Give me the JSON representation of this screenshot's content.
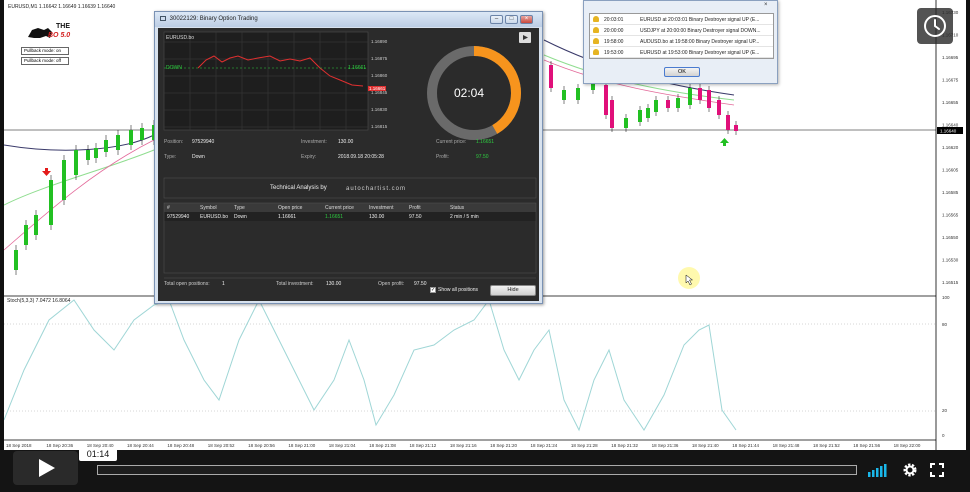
{
  "chart": {
    "header_text": "EURUSD,M1 1.16642 1.16649 1.16639 1.16640",
    "logo_text": "THE",
    "logo_bo": "BO 5.0",
    "pullback_on": "Pullback mode: on",
    "pullback_off": "Pullback mode: off",
    "stoch_label": "Stoch(5,3,3) 7.0472 16.8064",
    "price_ticks": [
      "1.16730",
      "1.16710",
      "1.16695",
      "1.16675",
      "1.16655",
      "1.16640",
      "1.16620",
      "1.16605",
      "1.16585",
      "1.16565",
      "1.16550",
      "1.16530",
      "1.16515"
    ],
    "current_price_tag": "1.16640",
    "stoch_ticks": [
      "100",
      "80",
      "20",
      "0"
    ],
    "time_ticks": [
      "18 Sep 2018",
      "18 Sep 20:36",
      "18 Sep 20:40",
      "18 Sep 20:44",
      "18 Sep 20:48",
      "18 Sep 20:52",
      "18 Sep 20:56",
      "18 Sep 21:00",
      "18 Sep 21:04",
      "18 Sep 21:08",
      "18 Sep 21:12",
      "18 Sep 21:16",
      "18 Sep 21:20",
      "18 Sep 21:24",
      "18 Sep 21:28",
      "18 Sep 21:32",
      "18 Sep 21:36",
      "18 Sep 21:40",
      "18 Sep 21:44",
      "18 Sep 21:48",
      "18 Sep 21:52",
      "18 Sep 21:56",
      "18 Sep 22:00"
    ]
  },
  "bo_window": {
    "title": "30022129: Binary Option Trading",
    "mini_chart_symbol": "EURUSD.bo",
    "down_label": "DOWN",
    "mini_price_tag": "1.16661",
    "mini_ticks": [
      "1.16890",
      "1.16875",
      "1.16860",
      "1.16845",
      "1.16830",
      "1.16815"
    ],
    "mini_current": "1.16661",
    "timer": "02:04",
    "position_label": "Position:",
    "position_value": "97529940",
    "investment_label": "Investment:",
    "investment_value": "130.00",
    "current_price_label": "Current price:",
    "current_price_value": "1.16651",
    "type_label": "Type:",
    "type_value": "Down",
    "expiry_label": "Expiry:",
    "expiry_value": "2018.09.18 20:05:28",
    "profit_label": "Profit:",
    "profit_value": "97.50",
    "ta_label": "Technical Analysis by",
    "ta_brand": "autochartist.com",
    "table_headers": [
      "#",
      "Symbol",
      "Type",
      "Open price",
      "Current price",
      "Investment",
      "Profit",
      "Status"
    ],
    "table_row": [
      "97529940",
      "EURUSD.bo",
      "Down",
      "1.16661",
      "1.16651",
      "130.00",
      "97.50",
      "2 min / 5 min"
    ],
    "total_open_label": "Total open positions:",
    "total_open_value": "1",
    "total_inv_label": "Total investment:",
    "total_inv_value": "130.00",
    "open_profit_label": "Open profit:",
    "open_profit_value": "97.50",
    "show_all": "Show all positions",
    "hide": "Hide"
  },
  "alert_window": {
    "rows": [
      {
        "time": "20:03:01",
        "msg": "EURUSD at 20:03:01 Binary Destroyer signal UP (E..."
      },
      {
        "time": "20:00:00",
        "msg": "USDJPY at 20:00:00 Binary Destroyer signal DOWN..."
      },
      {
        "time": "19:58:00",
        "msg": "AUDUSD.bo at 19:58:00 Binary Destroyer signal UP..."
      },
      {
        "time": "19:53:00",
        "msg": "EURUSD at 19:53:00 Binary Destroyer signal UP (E..."
      }
    ],
    "ok": "OK"
  },
  "player": {
    "time": "01:14",
    "progress": 0.0,
    "accent": "#1ab7ea"
  },
  "colors": {
    "timer_ring": "#f7941d",
    "bull": "#22c022",
    "bear": "#e0107a"
  }
}
